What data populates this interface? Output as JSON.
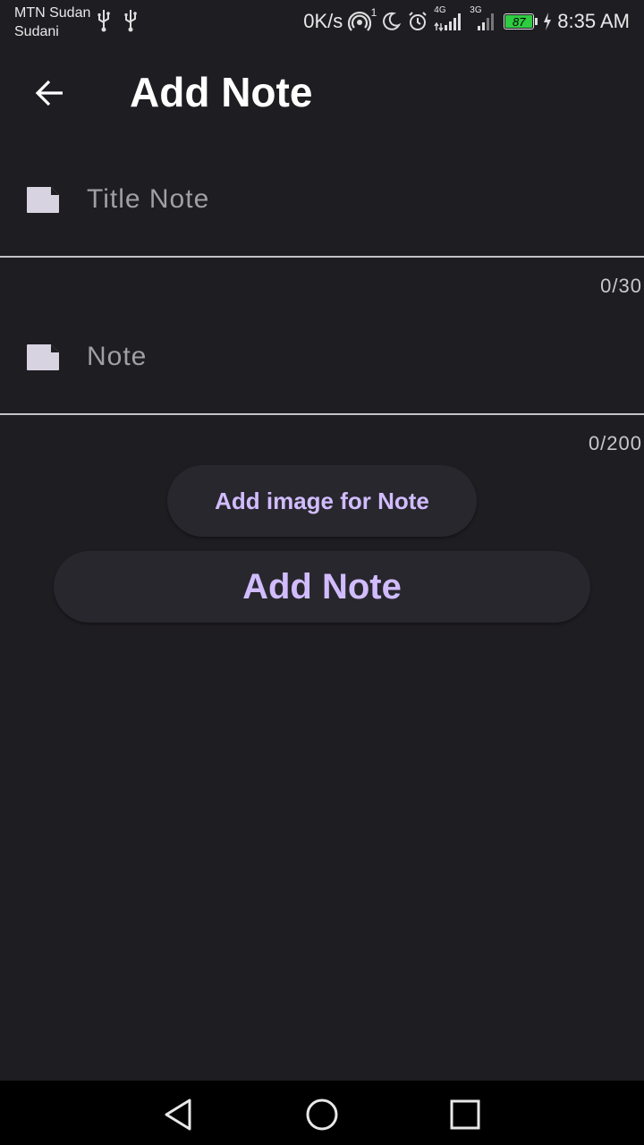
{
  "status_bar": {
    "carrier_line1": "MTN Sudan",
    "carrier_line2": "Sudani",
    "network_speed": "0K/s",
    "hotspot_count": "1",
    "signal1_label": "4G",
    "signal2_label": "3G",
    "battery_level": "87",
    "time": "8:35 AM"
  },
  "app_bar": {
    "title": "Add Note"
  },
  "form": {
    "title_field": {
      "placeholder": "Title Note",
      "value": "",
      "counter": "0/30"
    },
    "note_field": {
      "placeholder": "Note",
      "value": "",
      "counter": "0/200"
    }
  },
  "buttons": {
    "add_image_label": "Add image for Note",
    "add_note_label": "Add Note"
  },
  "colors": {
    "background": "#1e1d22",
    "accent": "#d1bcff",
    "button_bg": "#28272d",
    "battery": "#2ecc40"
  }
}
